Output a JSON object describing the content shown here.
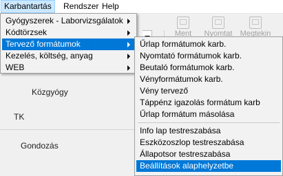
{
  "menubar": {
    "items": [
      {
        "label": "Karbantartás"
      },
      {
        "label": "Rendszer"
      },
      {
        "label": "Help"
      }
    ]
  },
  "toolbar": {
    "save_label": "Ment",
    "print_label": "Nyomtat",
    "open_label": "Megtekin"
  },
  "main_menu": {
    "items": [
      {
        "label": "Gyógyszerek - Laborvizsgálatok"
      },
      {
        "label": "Kódtörzsek"
      },
      {
        "label": "Tervező formátumok"
      },
      {
        "label": "Kezelés, költség, anyag"
      },
      {
        "label": "WEB"
      }
    ]
  },
  "submenu": {
    "group1": [
      {
        "label": "Űrlap formátumok karb."
      },
      {
        "label": "Nyomtató formátumok karb."
      },
      {
        "label": "Beutaló formátumok karb."
      },
      {
        "label": "Vényformátumok karb."
      },
      {
        "label": "Vény tervező"
      },
      {
        "label": "Táppénz igazolás formátum karb"
      },
      {
        "label": "Űrlap formátum másolása"
      }
    ],
    "group2": [
      {
        "label": "Info lap testreszabása"
      },
      {
        "label": "Eszközoszlop testreszabása"
      },
      {
        "label": "Állapotsor testreszabása"
      },
      {
        "label": "Beállítások alaphelyzetbe"
      }
    ]
  },
  "background": {
    "labels": [
      "Közgyógy",
      "TK",
      "Gondozás"
    ]
  },
  "colors": {
    "highlight": "#0078d7",
    "menu_bg": "#f2f2f2",
    "menubar_active": "#cce8ff"
  }
}
